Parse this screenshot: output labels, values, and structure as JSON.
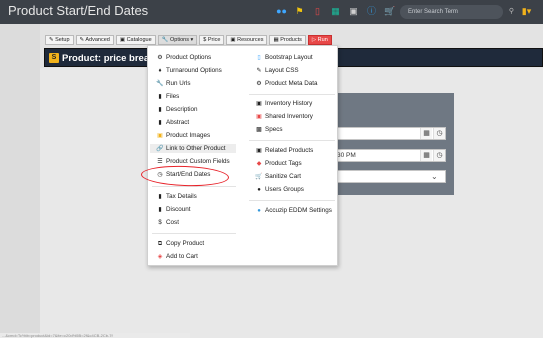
{
  "header": {
    "title": "Product Start/End Dates",
    "search_placeholder": "Enter Search Term",
    "icon_colors": {
      "users": "#3fa7ff",
      "flag": "#f1c40f",
      "scroll": "#e84848",
      "table": "#1abc9c",
      "camera": "#cfcfcf",
      "info": "#3498db",
      "cart": "#f1c40f",
      "doc": "#f1b21b"
    }
  },
  "toolbar": {
    "setup": "Setup",
    "advanced": "Advanced",
    "catalogue": "Catalogue",
    "options": "Options",
    "price": "Price",
    "resources": "Resources",
    "products": "Products",
    "run": "Run"
  },
  "product_bar": {
    "badge": "S",
    "title": "Product: price break h"
  },
  "form": {
    "time_value": "30 PM"
  },
  "menu": {
    "left": [
      {
        "label": "Product Options",
        "icon": "gear-icon"
      },
      {
        "label": "Turnaround Options",
        "icon": "diamond-icon"
      },
      {
        "label": "Run Urls",
        "icon": "wrench-icon"
      },
      {
        "label": "Files",
        "icon": "file-icon"
      },
      {
        "label": "Description",
        "icon": "file-icon"
      },
      {
        "label": "Abstract",
        "icon": "file-icon"
      },
      {
        "label": "Product Images",
        "icon": "image-icon"
      },
      {
        "label": "Link to Other Product",
        "icon": "link-icon"
      },
      {
        "label": "Product Custom Fields",
        "icon": "list-icon"
      },
      {
        "label": "Start/End Dates",
        "icon": "clock-icon"
      },
      {
        "label": "Tax Details",
        "icon": "file-icon"
      },
      {
        "label": "Discount",
        "icon": "file-icon"
      },
      {
        "label": "Cost",
        "icon": "dollar-icon"
      },
      {
        "label": "Copy Product",
        "icon": "copy-icon"
      },
      {
        "label": "Add to Cart",
        "icon": "gift-icon"
      }
    ],
    "right": [
      {
        "label": "Bootstrap Layout",
        "icon": "bootstrap-icon"
      },
      {
        "label": "Layout CSS",
        "icon": "css-icon"
      },
      {
        "label": "Product Meta Data",
        "icon": "meta-icon"
      },
      {
        "label": "Inventory History",
        "icon": "cubes-icon"
      },
      {
        "label": "Shared Inventory",
        "icon": "cubes-icon"
      },
      {
        "label": "Specs",
        "icon": "specs-icon"
      },
      {
        "label": "Related Products",
        "icon": "cubes-icon"
      },
      {
        "label": "Product Tags",
        "icon": "tag-icon"
      },
      {
        "label": "Sanitize Cart",
        "icon": "cart-icon"
      },
      {
        "label": "Users Groups",
        "icon": "users-icon"
      },
      {
        "label": "Accuzip EDDM Settings",
        "icon": "globe-icon"
      }
    ]
  },
  "status_text": "...&cmd=Tc%tb=product&id=7&ite=c20d%5B=2f&c4CB-2Cb-7f"
}
